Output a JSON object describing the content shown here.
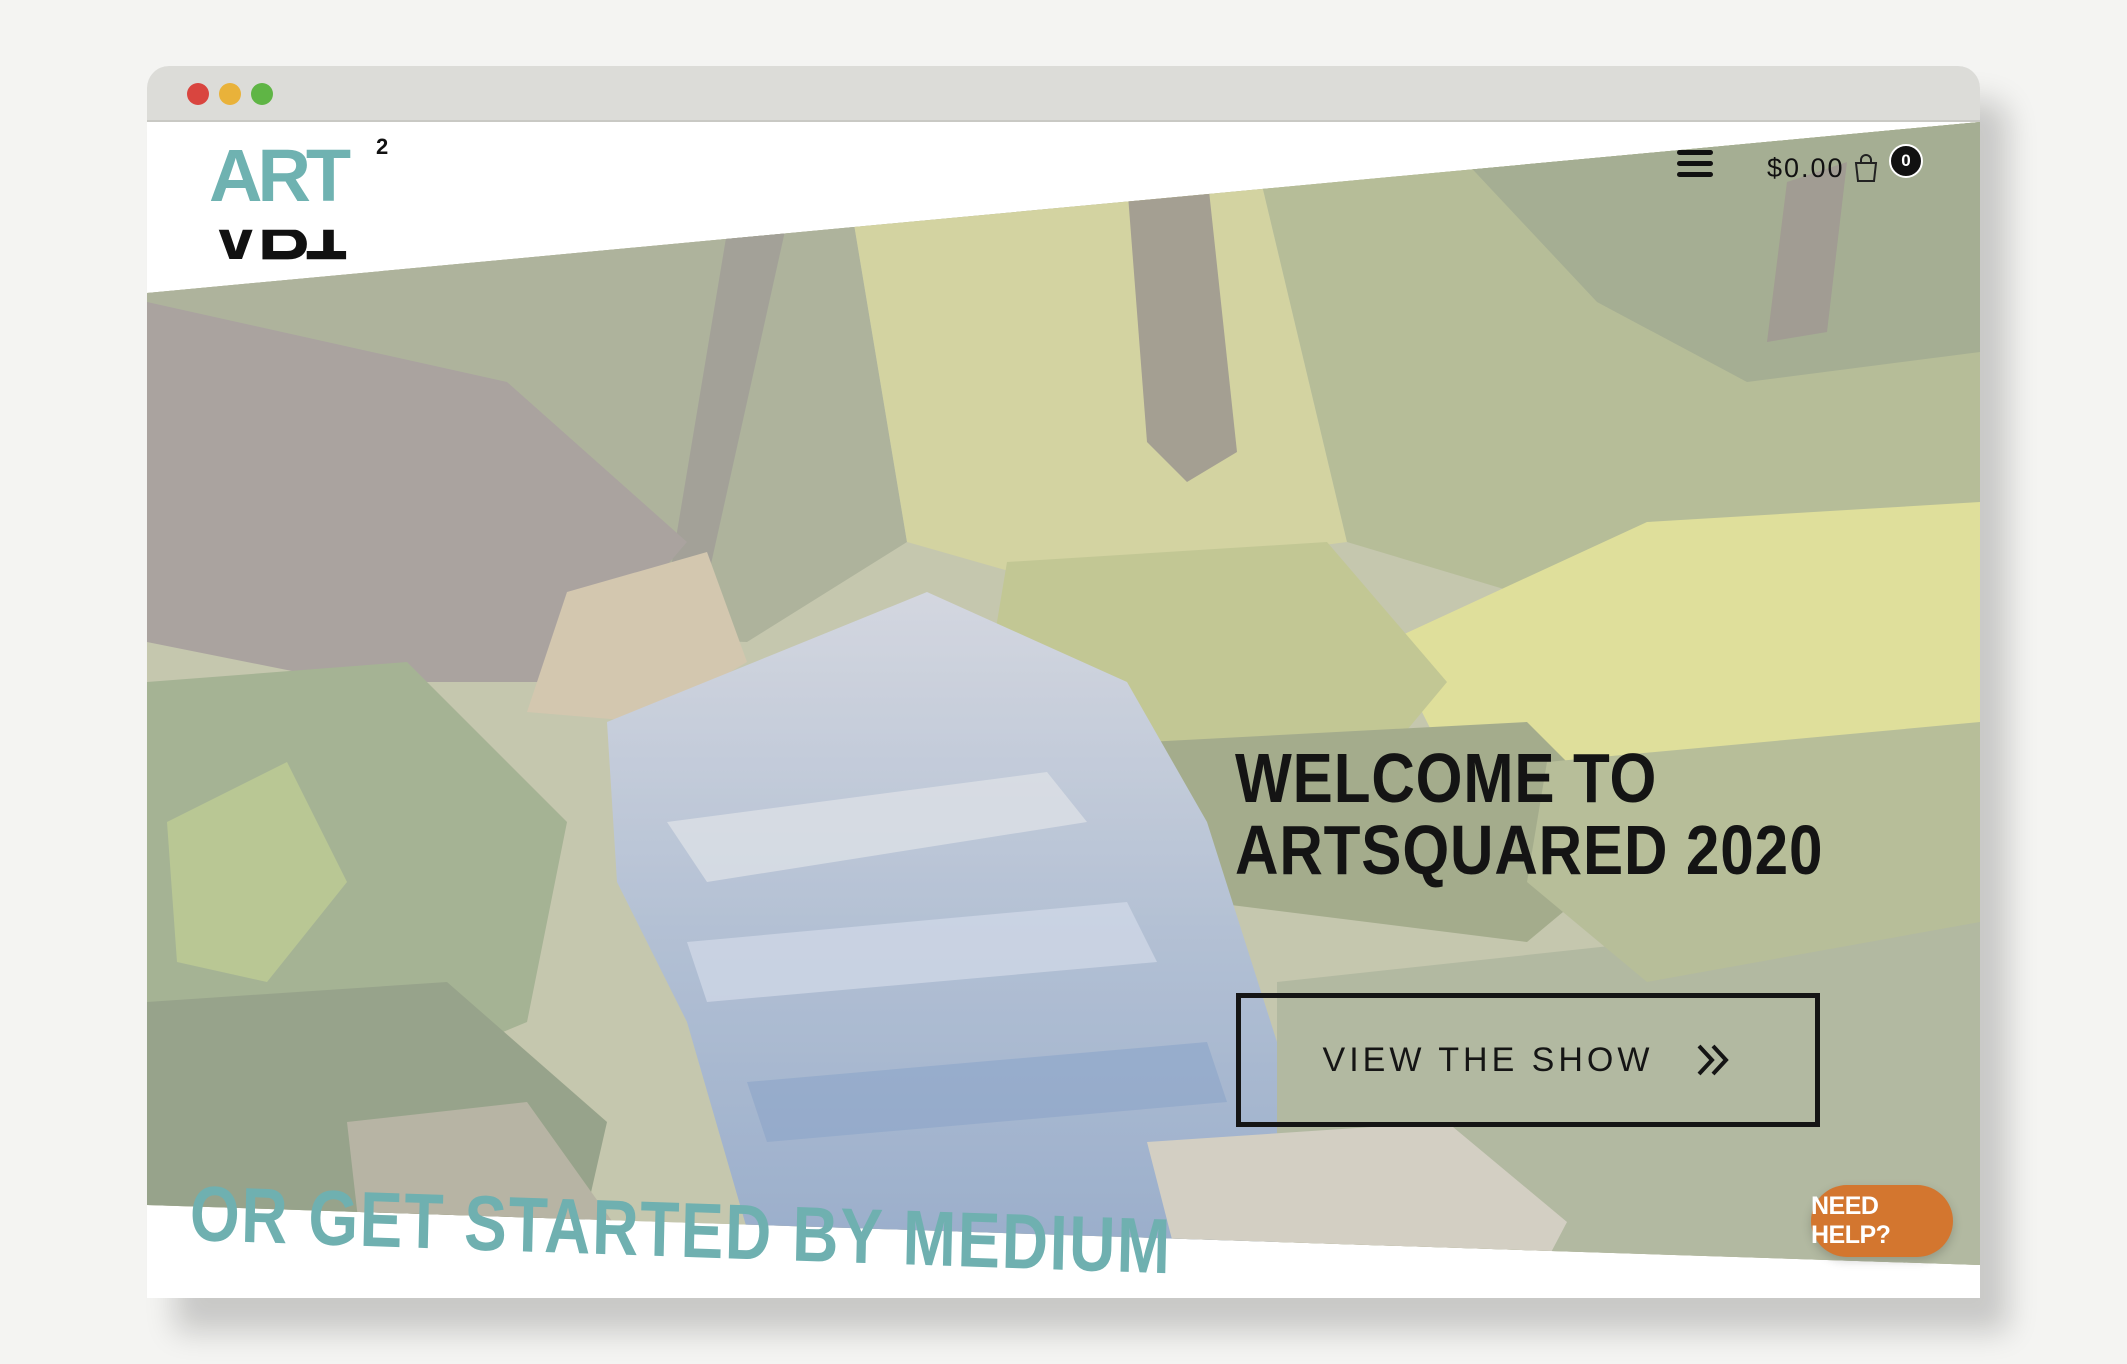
{
  "brand": {
    "logo_top": "ART",
    "logo_bottom": "ART",
    "logo_superscript": "2"
  },
  "header": {
    "menu_icon": "hamburger-menu-icon",
    "cart_total": "$0.00",
    "cart_icon": "shopping-bag-icon",
    "cart_count": "0"
  },
  "hero": {
    "title_line1": "WELCOME TO",
    "title_line2": "ARTSQUARED 2020",
    "cta_label": "VIEW THE SHOW",
    "cta_icon": "double-chevron-right-icon",
    "image": "watercolor-forest-stream"
  },
  "section": {
    "title": "OR GET STARTED BY MEDIUM"
  },
  "help": {
    "label": "NEED HELP?"
  },
  "colors": {
    "accent_teal": "#6fb2b1",
    "help_orange": "#d3762f",
    "text_dark": "#141414",
    "window_dots": [
      "#d9453f",
      "#e9b23a",
      "#5fb545"
    ]
  }
}
